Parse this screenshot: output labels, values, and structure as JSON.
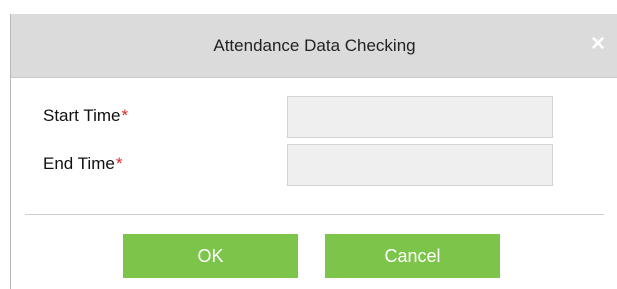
{
  "dialog": {
    "title": "Attendance Data Checking",
    "close_symbol": "×"
  },
  "form": {
    "start_time": {
      "label": "Start Time",
      "required_mark": "*",
      "value": ""
    },
    "end_time": {
      "label": "End Time",
      "required_mark": "*",
      "value": ""
    }
  },
  "buttons": {
    "ok_label": "OK",
    "cancel_label": "Cancel"
  },
  "colors": {
    "titlebar_bg": "#dbdbdb",
    "button_green": "#7dc44a",
    "required_red": "#e02424",
    "input_bg": "#efefef"
  },
  "icons": {
    "close": "close-icon"
  }
}
